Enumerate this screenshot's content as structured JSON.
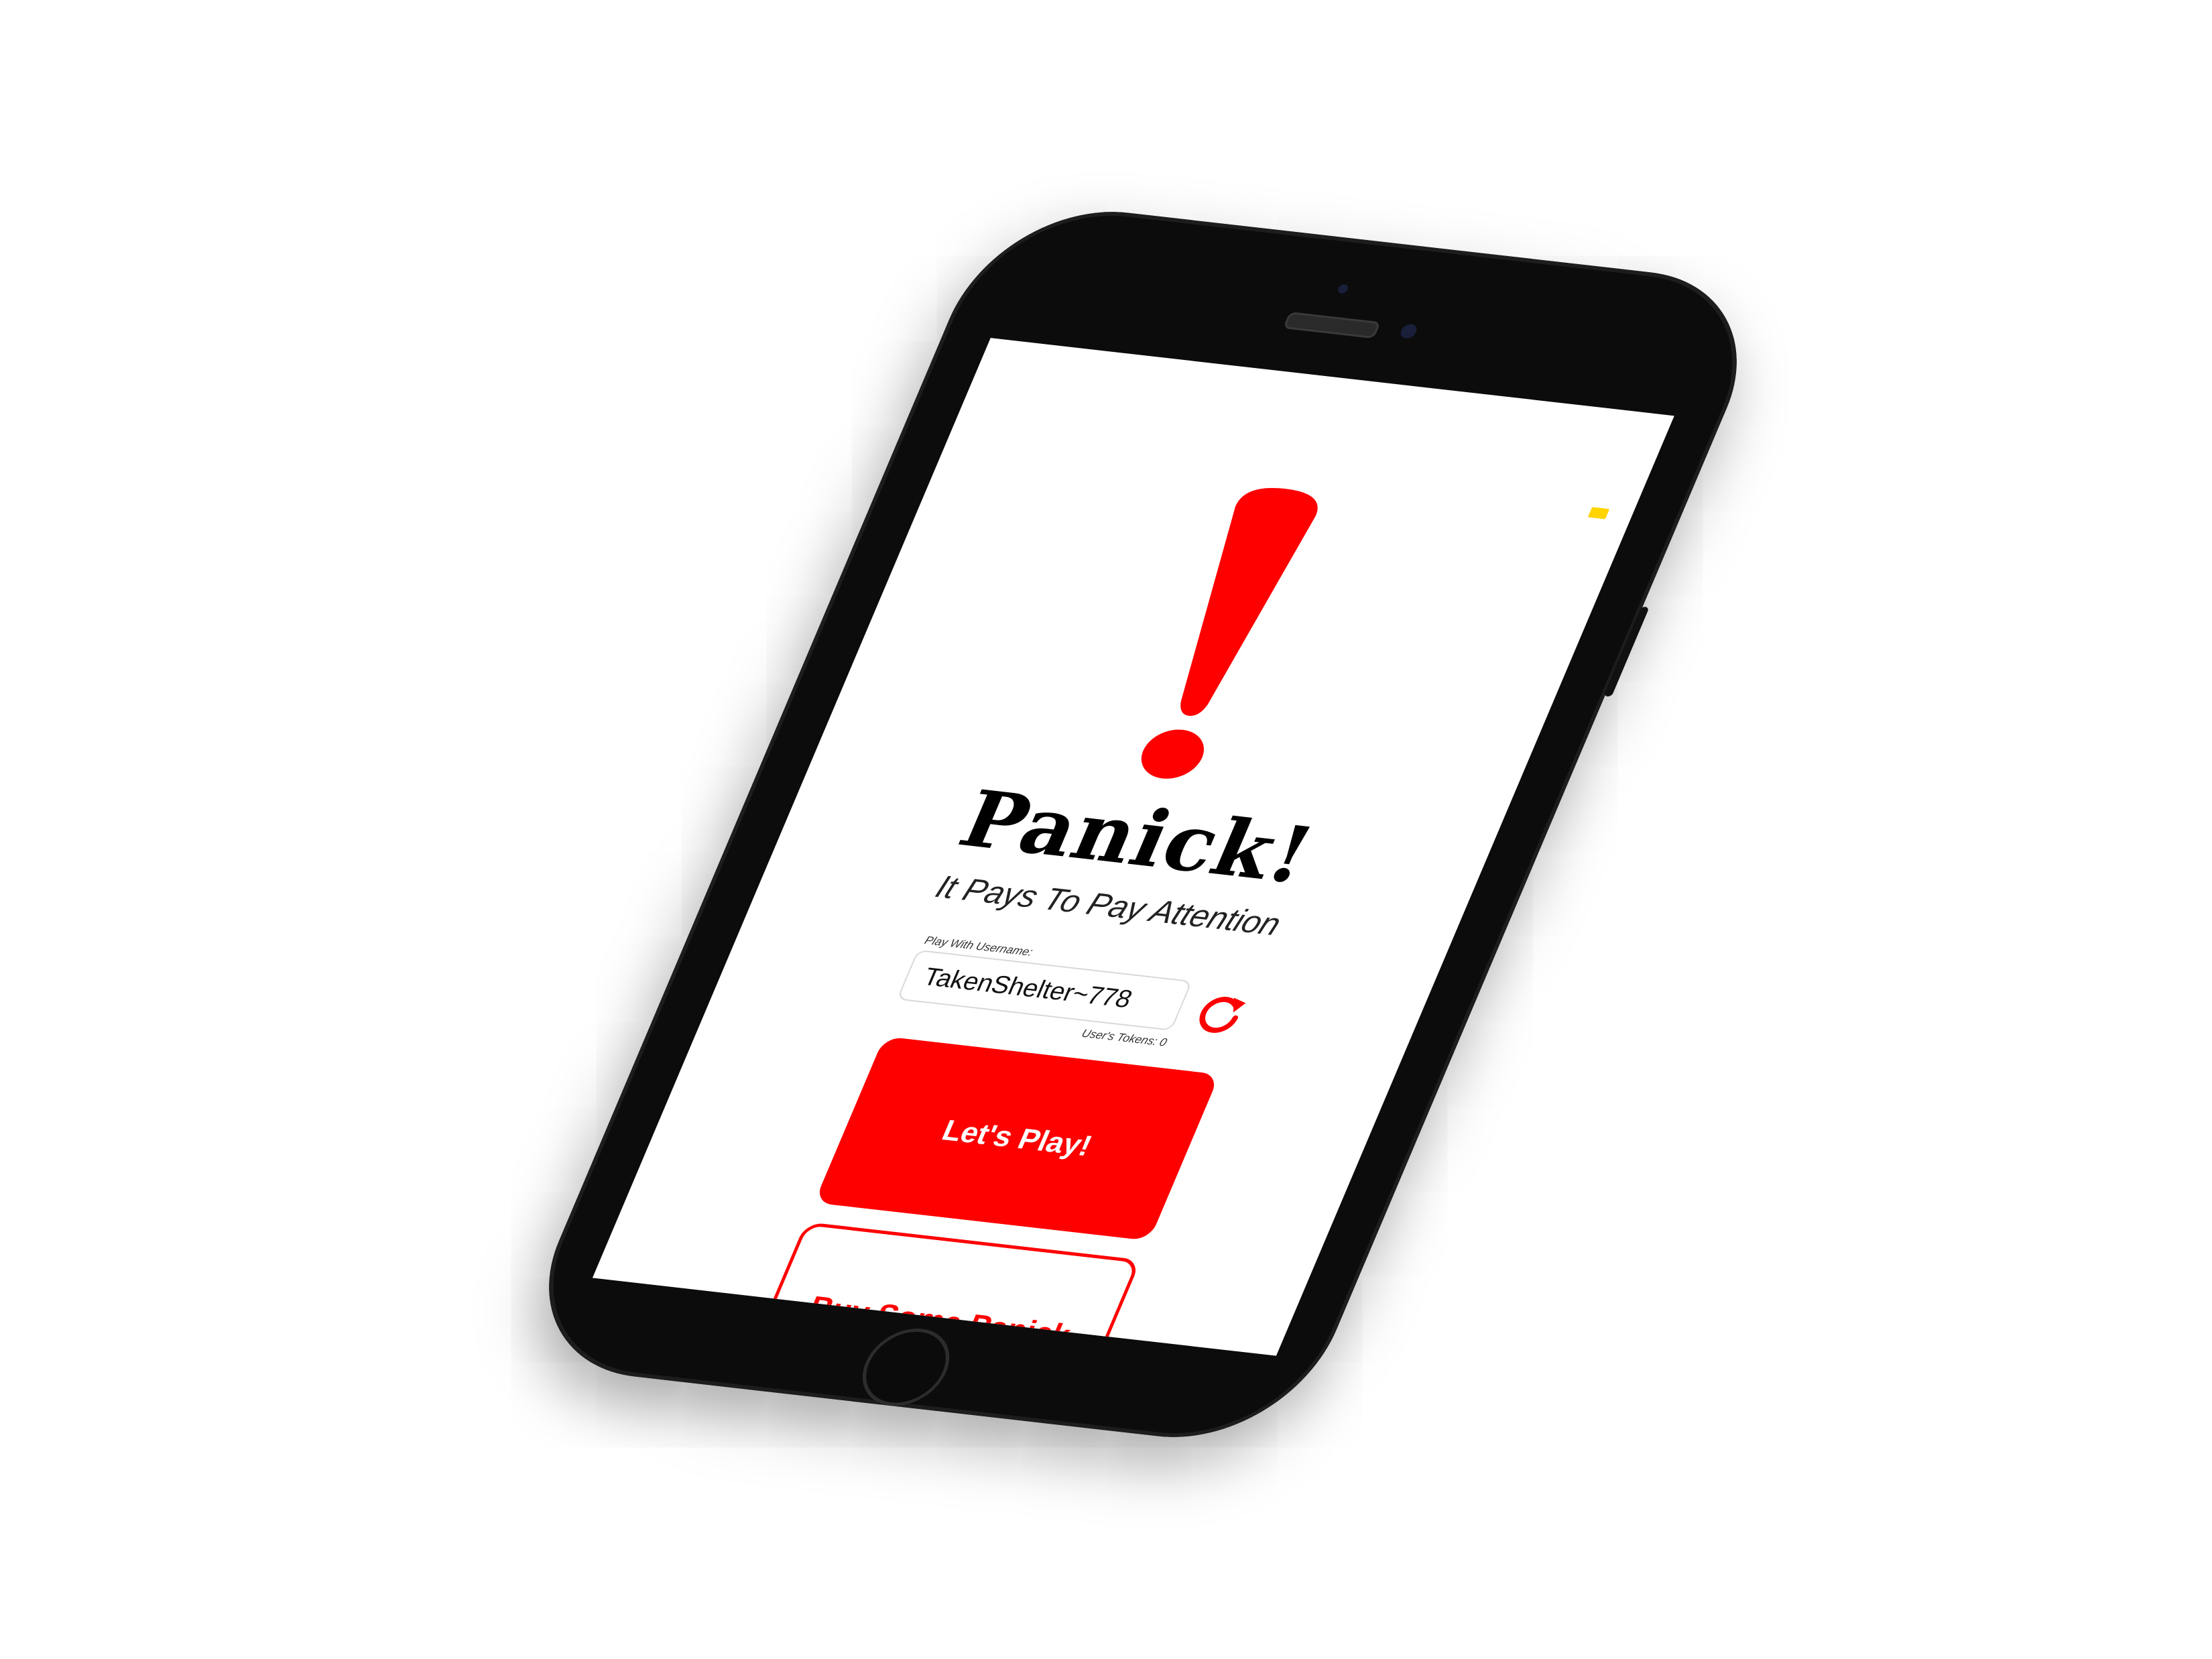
{
  "app": {
    "title": "Panick!",
    "tagline": "It Pays To Pay Attention"
  },
  "username": {
    "label": "Play With Username:",
    "value": "TakenShelter~778"
  },
  "tokens": {
    "text": "User's Tokens: 0"
  },
  "buttons": {
    "play_label": "Let's Play!",
    "buy_label": "Buy Some Panick"
  },
  "icons": {
    "hero": "exclamation-mark-icon",
    "refresh": "refresh-icon"
  },
  "colors": {
    "accent": "#ff0000",
    "status": "#ffd400",
    "device": "#0c0c0c"
  }
}
